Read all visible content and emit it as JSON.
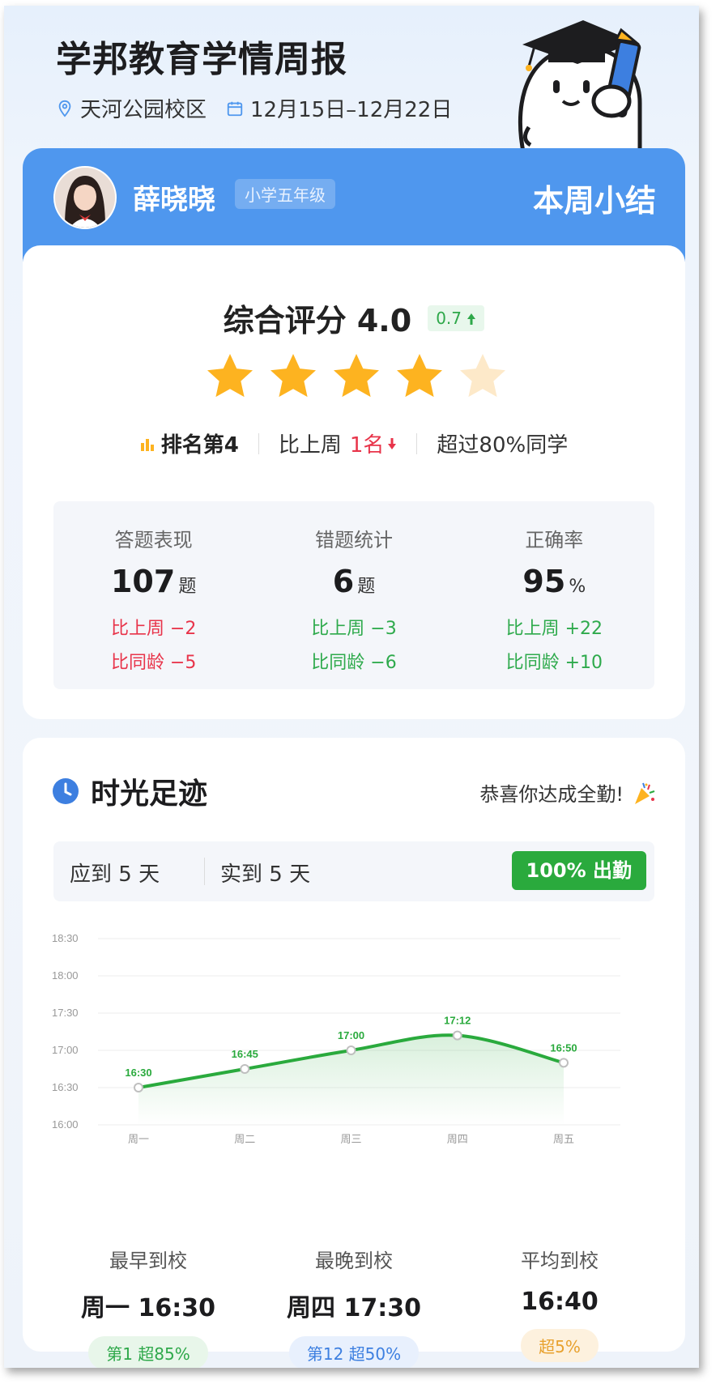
{
  "report": {
    "title": "学邦教育学情周报",
    "campus": "天河公园校区",
    "date_range": "12月15日–12月22日"
  },
  "student": {
    "name": "薛晓晓",
    "grade": "小学五年级",
    "summary_label": "本周小结"
  },
  "score": {
    "label": "综合评分 4.0",
    "delta": "0.7",
    "stars_filled": 4,
    "stars_total": 5
  },
  "rank": {
    "rank_text": "排名第4",
    "compare_prefix": "比上周",
    "compare_value": "1名",
    "exceed": "超过80%同学"
  },
  "stats": [
    {
      "label": "答题表现",
      "value": "107",
      "unit": "题",
      "c1": "比上周 −2",
      "c2": "比同龄 −5",
      "color": "#e8344a"
    },
    {
      "label": "错题统计",
      "value": "6",
      "unit": "题",
      "c1": "比上周 −3",
      "c2": "比同龄 −6",
      "color": "#2eaa4c"
    },
    {
      "label": "正确率",
      "value": "95",
      "unit": "%",
      "c1": "比上周 +22",
      "c2": "比同龄 +10",
      "color": "#2eaa4c"
    }
  ],
  "timeline": {
    "title": "时光足迹",
    "congrats": "恭喜你达成全勤!",
    "expected": "应到 5 天",
    "actual": "实到 5 天",
    "rate_button": "100% 出勤"
  },
  "chart_data": {
    "type": "line",
    "categories": [
      "周一",
      "周二",
      "周三",
      "周四",
      "周五"
    ],
    "y_ticks": [
      "16:00",
      "16:30",
      "17:00",
      "17:30",
      "18:00",
      "18:30"
    ],
    "ylim_minutes": [
      960,
      1110
    ],
    "series": [
      {
        "values_minutes": [
          990,
          1005,
          1020,
          1032,
          1010
        ],
        "labels": [
          "16:30",
          "16:45",
          "17:00",
          "17:12",
          "16:50"
        ],
        "color": "#2aaa3d"
      }
    ],
    "grid": true
  },
  "bottom": [
    {
      "label": "最早到校",
      "value": "周一 16:30",
      "pill": "第1 超85%",
      "pill_class": "p-green"
    },
    {
      "label": "最晚到校",
      "value": "周四 17:30",
      "pill": "第12 超50%",
      "pill_class": "p-blue"
    },
    {
      "label": "平均到校",
      "value": "16:40",
      "pill": "超5%",
      "pill_class": "p-orange"
    }
  ],
  "colors": {
    "primary": "#4f97ee",
    "green": "#2aaa3d",
    "red": "#e8344a",
    "star": "#fdb320",
    "star_empty": "#fde9c9"
  },
  "icons": [
    "location-icon",
    "calendar-icon",
    "bar-rank-icon",
    "arrow-up-icon",
    "arrow-down-icon",
    "clock-icon",
    "party-popper-icon",
    "star-icon"
  ]
}
